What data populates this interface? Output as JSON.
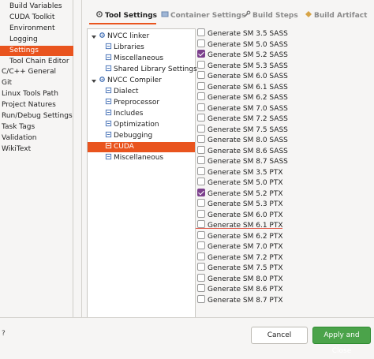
{
  "left_nav": {
    "items": [
      {
        "label": "Build Variables",
        "indent": 1,
        "selected": false
      },
      {
        "label": "CUDA Toolkit",
        "indent": 1,
        "selected": false
      },
      {
        "label": "Environment",
        "indent": 1,
        "selected": false
      },
      {
        "label": "Logging",
        "indent": 1,
        "selected": false
      },
      {
        "label": "Settings",
        "indent": 1,
        "selected": true
      },
      {
        "label": "Tool Chain Editor",
        "indent": 1,
        "selected": false
      },
      {
        "label": "C/C++ General",
        "indent": 0,
        "selected": false
      },
      {
        "label": "Git",
        "indent": 0,
        "selected": false
      },
      {
        "label": "Linux Tools Path",
        "indent": 0,
        "selected": false
      },
      {
        "label": "Project Natures",
        "indent": 0,
        "selected": false
      },
      {
        "label": "Run/Debug Settings",
        "indent": 0,
        "selected": false
      },
      {
        "label": "Task Tags",
        "indent": 0,
        "selected": false
      },
      {
        "label": "Validation",
        "indent": 0,
        "selected": false
      },
      {
        "label": "WikiText",
        "indent": 0,
        "selected": false
      }
    ]
  },
  "tabs": [
    {
      "label": "Tool Settings",
      "active": true
    },
    {
      "label": "Container Settings",
      "active": false
    },
    {
      "label": "Build Steps",
      "active": false
    },
    {
      "label": "Build Artifact",
      "active": false
    }
  ],
  "tree": {
    "nodes": [
      {
        "label": "NVCC linker",
        "level": 0,
        "expanded": true,
        "selected": false
      },
      {
        "label": "Libraries",
        "level": 1,
        "selected": false
      },
      {
        "label": "Miscellaneous",
        "level": 1,
        "selected": false
      },
      {
        "label": "Shared Library Settings",
        "level": 1,
        "selected": false
      },
      {
        "label": "NVCC Compiler",
        "level": 0,
        "expanded": true,
        "selected": false
      },
      {
        "label": "Dialect",
        "level": 1,
        "selected": false
      },
      {
        "label": "Preprocessor",
        "level": 1,
        "selected": false
      },
      {
        "label": "Includes",
        "level": 1,
        "selected": false
      },
      {
        "label": "Optimization",
        "level": 1,
        "selected": false
      },
      {
        "label": "Debugging",
        "level": 1,
        "selected": false
      },
      {
        "label": "CUDA",
        "level": 1,
        "selected": true
      },
      {
        "label": "Miscellaneous",
        "level": 1,
        "selected": false
      }
    ]
  },
  "options": [
    {
      "label": "Generate SM 3.5 SASS",
      "checked": false
    },
    {
      "label": "Generate SM 5.0 SASS",
      "checked": false
    },
    {
      "label": "Generate SM 5.2 SASS",
      "checked": true
    },
    {
      "label": "Generate SM 5.3 SASS",
      "checked": false
    },
    {
      "label": "Generate SM 6.0 SASS",
      "checked": false
    },
    {
      "label": "Generate SM 6.1 SASS",
      "checked": false
    },
    {
      "label": "Generate SM 6.2 SASS",
      "checked": false
    },
    {
      "label": "Generate SM 7.0 SASS",
      "checked": false
    },
    {
      "label": "Generate SM 7.2 SASS",
      "checked": false
    },
    {
      "label": "Generate SM 7.5 SASS",
      "checked": false
    },
    {
      "label": "Generate SM 8.0 SASS",
      "checked": false
    },
    {
      "label": "Generate SM 8.6 SASS",
      "checked": false
    },
    {
      "label": "Generate SM 8.7 SASS",
      "checked": false
    },
    {
      "label": "Generate SM 3.5 PTX",
      "checked": false
    },
    {
      "label": "Generate SM 5.0 PTX",
      "checked": false
    },
    {
      "label": "Generate SM 5.2 PTX",
      "checked": true
    },
    {
      "label": "Generate SM 5.3 PTX",
      "checked": false
    },
    {
      "label": "Generate SM 6.0 PTX",
      "checked": false
    },
    {
      "label": "Generate SM 6.1 PTX",
      "checked": false
    },
    {
      "label": "Generate SM 6.2 PTX",
      "checked": false
    },
    {
      "label": "Generate SM 7.0 PTX",
      "checked": false
    },
    {
      "label": "Generate SM 7.2 PTX",
      "checked": false
    },
    {
      "label": "Generate SM 7.5 PTX",
      "checked": false
    },
    {
      "label": "Generate SM 8.0 PTX",
      "checked": false
    },
    {
      "label": "Generate SM 8.6 PTX",
      "checked": false
    },
    {
      "label": "Generate SM 8.7 PTX",
      "checked": false
    }
  ],
  "footer": {
    "help_label": "?",
    "cancel_label": "Cancel",
    "apply_close_label": "Apply and Close"
  },
  "colors": {
    "selection": "#e9541e",
    "checkbox_checked": "#7b3f8c",
    "apply_button": "#4ba34a"
  }
}
